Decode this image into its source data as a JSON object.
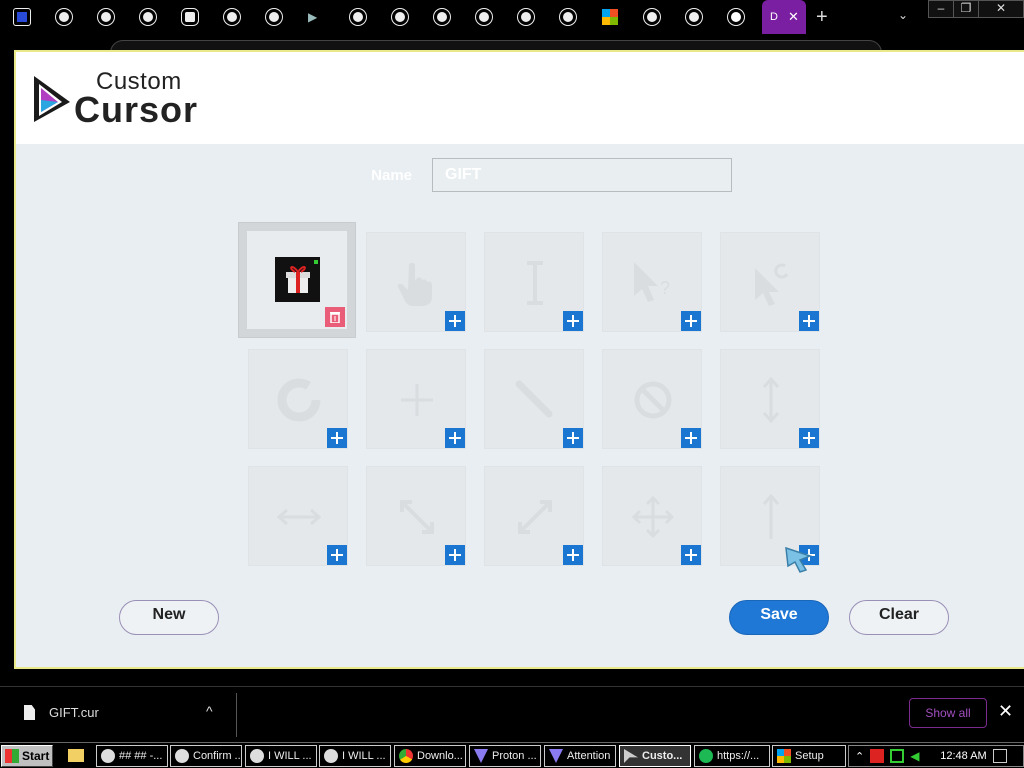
{
  "browser": {
    "active_tab": {
      "title": "D",
      "favicon": "custom-cursor-icon"
    },
    "new_tab_symbol": "+",
    "tab_menu_symbol": "⌄",
    "close_tab_symbol": "✕"
  },
  "app": {
    "logo": {
      "line1": "Custom",
      "line2": "Cursor"
    },
    "name_field": {
      "label": "Name",
      "value": "GIFT"
    },
    "cursor_slots": [
      {
        "id": "normal",
        "icon": "gift-thumbnail",
        "assigned": true
      },
      {
        "id": "link",
        "icon": "hand-pointer-icon",
        "assigned": false
      },
      {
        "id": "text",
        "icon": "text-cursor-icon",
        "assigned": false
      },
      {
        "id": "help",
        "icon": "help-arrow-icon",
        "assigned": false
      },
      {
        "id": "working",
        "icon": "arrow-working-icon",
        "assigned": false
      },
      {
        "id": "busy",
        "icon": "busy-ring-icon",
        "assigned": false
      },
      {
        "id": "precision",
        "icon": "crosshair-icon",
        "assigned": false
      },
      {
        "id": "handwriting",
        "icon": "pen-icon",
        "assigned": false
      },
      {
        "id": "unavailable",
        "icon": "no-entry-icon",
        "assigned": false
      },
      {
        "id": "vertical-resize",
        "icon": "resize-vertical-icon",
        "assigned": false
      },
      {
        "id": "horizontal-resize",
        "icon": "resize-horizontal-icon",
        "assigned": false
      },
      {
        "id": "diagonal-resize-1",
        "icon": "resize-diagonal-nwse-icon",
        "assigned": false
      },
      {
        "id": "diagonal-resize-2",
        "icon": "resize-diagonal-nesw-icon",
        "assigned": false
      },
      {
        "id": "move",
        "icon": "move-icon",
        "assigned": false
      },
      {
        "id": "alternate",
        "icon": "up-arrow-icon",
        "assigned": false
      }
    ],
    "buttons": {
      "new": "New",
      "save": "Save",
      "clear": "Clear"
    },
    "colors": {
      "accent": "#1f77d6",
      "delete": "#ea5d79",
      "background": "#e8eef2"
    }
  },
  "download_shelf": {
    "file_name": "GIFT.cur",
    "show_all": "Show all",
    "close_symbol": "✕",
    "expand_symbol": "^"
  },
  "taskbar": {
    "start": "Start",
    "tasks": [
      {
        "label": "## ## -...",
        "icon": "chrome-icon"
      },
      {
        "label": "Confirm ...",
        "icon": "chrome-icon"
      },
      {
        "label": "I WILL ...",
        "icon": "chrome-icon"
      },
      {
        "label": "I WILL ...",
        "icon": "chrome-icon"
      },
      {
        "label": "Downlo...",
        "icon": "chrome-icon"
      },
      {
        "label": "Proton ...",
        "icon": "proton-icon"
      },
      {
        "label": "Attention",
        "icon": "proton-icon"
      },
      {
        "label": "Custo...",
        "icon": "cursor-icon",
        "active": true
      },
      {
        "label": "https://...",
        "icon": "spotify-icon"
      },
      {
        "label": "Setup",
        "icon": "setup-icon"
      }
    ],
    "clock": "12:48 AM"
  }
}
